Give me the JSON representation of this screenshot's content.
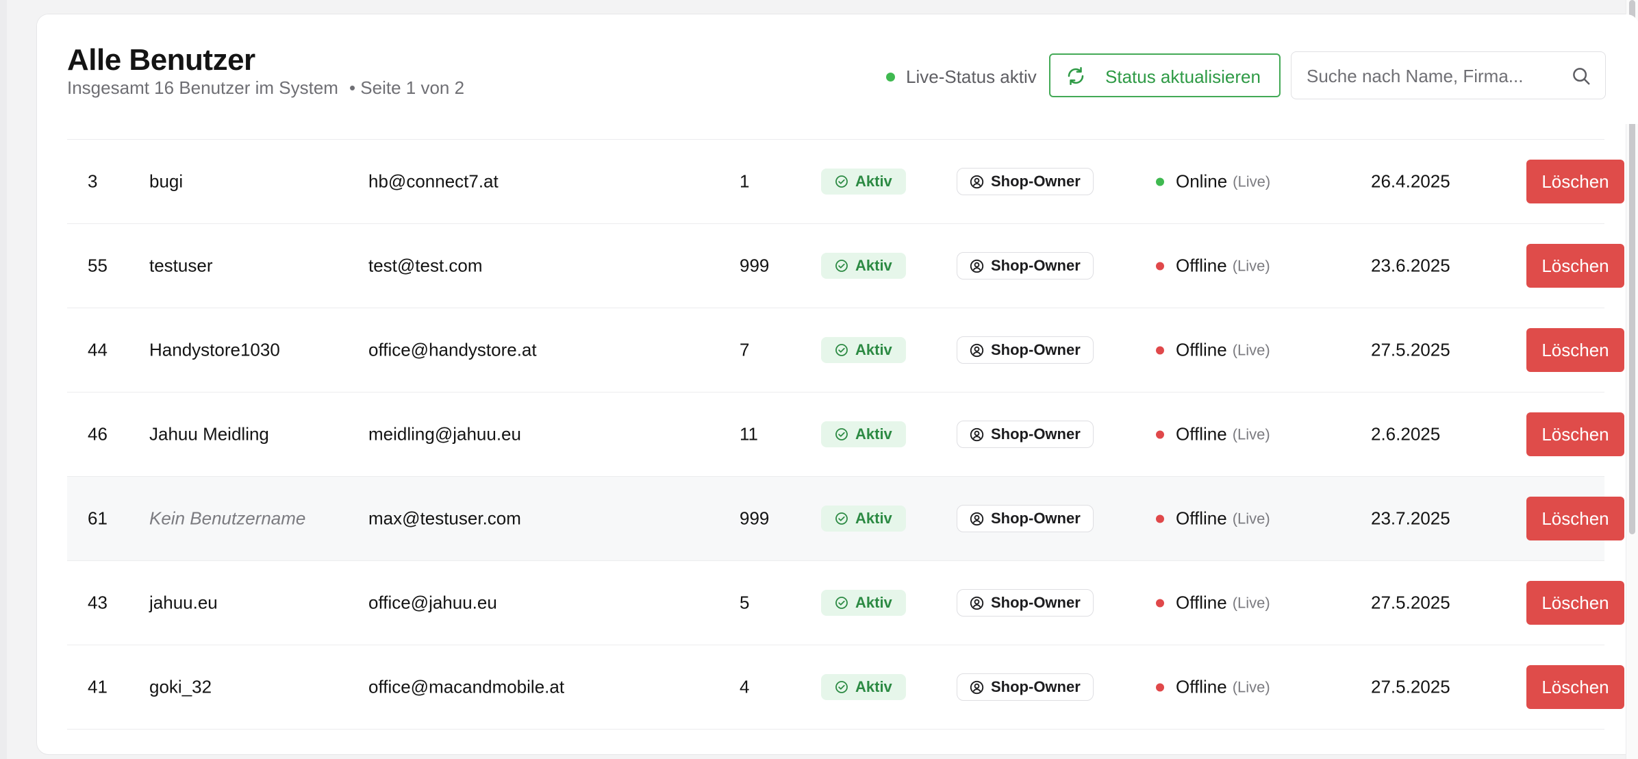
{
  "header": {
    "title": "Alle Benutzer",
    "subtitle": "Insgesamt 16 Benutzer im System",
    "page_info": "• Seite 1 von 2",
    "live_status": "Live-Status aktiv",
    "refresh_label": "Status aktualisieren",
    "search_placeholder": "Suche nach Name, Firma..."
  },
  "colors": {
    "accent_green": "#2e9a45",
    "online_dot": "#3fb950",
    "offline_dot": "#e0484a",
    "delete_button": "#df4c4a"
  },
  "rows": [
    {
      "id": "3",
      "name": "bugi",
      "email": "hb@connect7.at",
      "count": "1",
      "state": "Aktiv",
      "role": "Shop-Owner",
      "status": "Online",
      "status_live": "(Live)",
      "date": "26.4.2025",
      "action": "Löschen"
    },
    {
      "id": "55",
      "name": "testuser",
      "email": "test@test.com",
      "count": "999",
      "state": "Aktiv",
      "role": "Shop-Owner",
      "status": "Offline",
      "status_live": "(Live)",
      "date": "23.6.2025",
      "action": "Löschen"
    },
    {
      "id": "44",
      "name": "Handystore1030",
      "email": "office@handystore.at",
      "count": "7",
      "state": "Aktiv",
      "role": "Shop-Owner",
      "status": "Offline",
      "status_live": "(Live)",
      "date": "27.5.2025",
      "action": "Löschen"
    },
    {
      "id": "46",
      "name": "Jahuu Meidling",
      "email": "meidling@jahuu.eu",
      "count": "11",
      "state": "Aktiv",
      "role": "Shop-Owner",
      "status": "Offline",
      "status_live": "(Live)",
      "date": "2.6.2025",
      "action": "Löschen"
    },
    {
      "id": "61",
      "name": "Kein Benutzername",
      "email": "max@testuser.com",
      "count": "999",
      "state": "Aktiv",
      "role": "Shop-Owner",
      "status": "Offline",
      "status_live": "(Live)",
      "date": "23.7.2025",
      "action": "Löschen"
    },
    {
      "id": "43",
      "name": "jahuu.eu",
      "email": "office@jahuu.eu",
      "count": "5",
      "state": "Aktiv",
      "role": "Shop-Owner",
      "status": "Offline",
      "status_live": "(Live)",
      "date": "27.5.2025",
      "action": "Löschen"
    },
    {
      "id": "41",
      "name": "goki_32",
      "email": "office@macandmobile.at",
      "count": "4",
      "state": "Aktiv",
      "role": "Shop-Owner",
      "status": "Offline",
      "status_live": "(Live)",
      "date": "27.5.2025",
      "action": "Löschen"
    }
  ]
}
